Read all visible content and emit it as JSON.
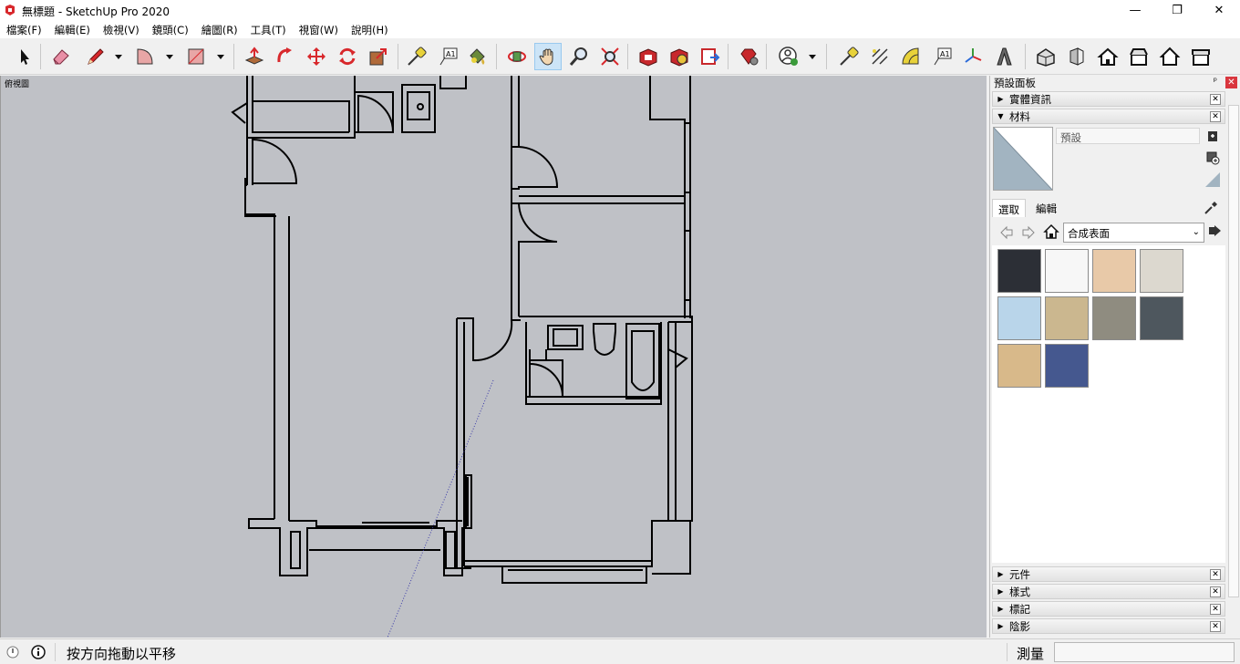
{
  "window": {
    "title": "無標題 - SketchUp Pro 2020",
    "minimize": "—",
    "maximize": "❐",
    "close": "✕"
  },
  "menu": [
    "檔案(F)",
    "編輯(E)",
    "檢視(V)",
    "鏡頭(C)",
    "繪圖(R)",
    "工具(T)",
    "視窗(W)",
    "說明(H)"
  ],
  "toolbar": {
    "icons": [
      "select-icon",
      "eraser-icon",
      "pencil-line-icon",
      "arc-icon",
      "rectangle-icon",
      "push-pull-icon",
      "follow-me-icon",
      "move-icon",
      "rotate-icon",
      "scale-icon",
      "tape-measure-icon",
      "text-icon",
      "paint-bucket-icon",
      "orbit-icon",
      "pan-icon",
      "zoom-icon",
      "zoom-extents-icon",
      "warehouse-icon",
      "extension-warehouse-icon",
      "send-to-layout-icon",
      "ruby-icon",
      "user-account-icon",
      "tape-measure-2-icon",
      "dimension-icon",
      "protractor-icon",
      "text-2-icon",
      "axes-icon",
      "3d-text-icon",
      "iso-view-icon",
      "front-view-icon",
      "top-view-icon",
      "right-view-icon",
      "back-view-icon",
      "left-view-icon"
    ]
  },
  "viewport": {
    "scene_label": "俯視圖",
    "background": "#bfc1c6"
  },
  "tray": {
    "title": "預設面板",
    "pin": "ᵖ",
    "close": "✕",
    "panels_top": [
      {
        "label": "實體資訊",
        "expanded": false
      },
      {
        "label": "材料",
        "expanded": true
      }
    ],
    "materials": {
      "current_name": "預設",
      "tabs": [
        "選取",
        "編輯"
      ],
      "active_tab": "選取",
      "collection": "合成表面",
      "swatches": [
        "#2c2f36",
        "#f7f7f7",
        "#e8c9a8",
        "#dcd8cf",
        "#b9d5ea",
        "#cbb78f",
        "#8f8c80",
        "#4e575e",
        "#d8b98a",
        "#45588f"
      ]
    },
    "panels_bottom": [
      {
        "label": "元件"
      },
      {
        "label": "樣式"
      },
      {
        "label": "標記"
      },
      {
        "label": "陰影"
      }
    ]
  },
  "status": {
    "message": "按方向拖動以平移",
    "measure_label": "測量",
    "measure_value": ""
  }
}
